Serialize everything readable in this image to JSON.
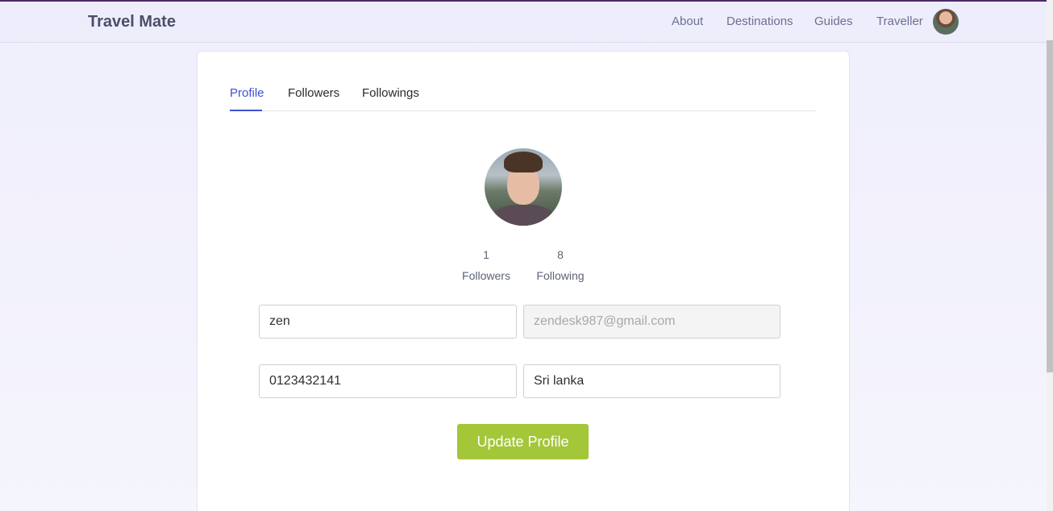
{
  "navbar": {
    "brand": "Travel Mate",
    "links": [
      "About",
      "Destinations",
      "Guides",
      "Traveller"
    ]
  },
  "tabs": [
    {
      "label": "Profile",
      "active": true
    },
    {
      "label": "Followers",
      "active": false
    },
    {
      "label": "Followings",
      "active": false
    }
  ],
  "stats": {
    "followers_count": "1",
    "followers_label": "Followers",
    "following_count": "8",
    "following_label": "Following"
  },
  "form": {
    "name": "zen",
    "email": "zendesk987@gmail.com",
    "phone": "0123432141",
    "country": "Sri lanka",
    "submit_label": "Update Profile"
  },
  "colors": {
    "accent": "#3f51d4",
    "button": "#a4c639"
  }
}
